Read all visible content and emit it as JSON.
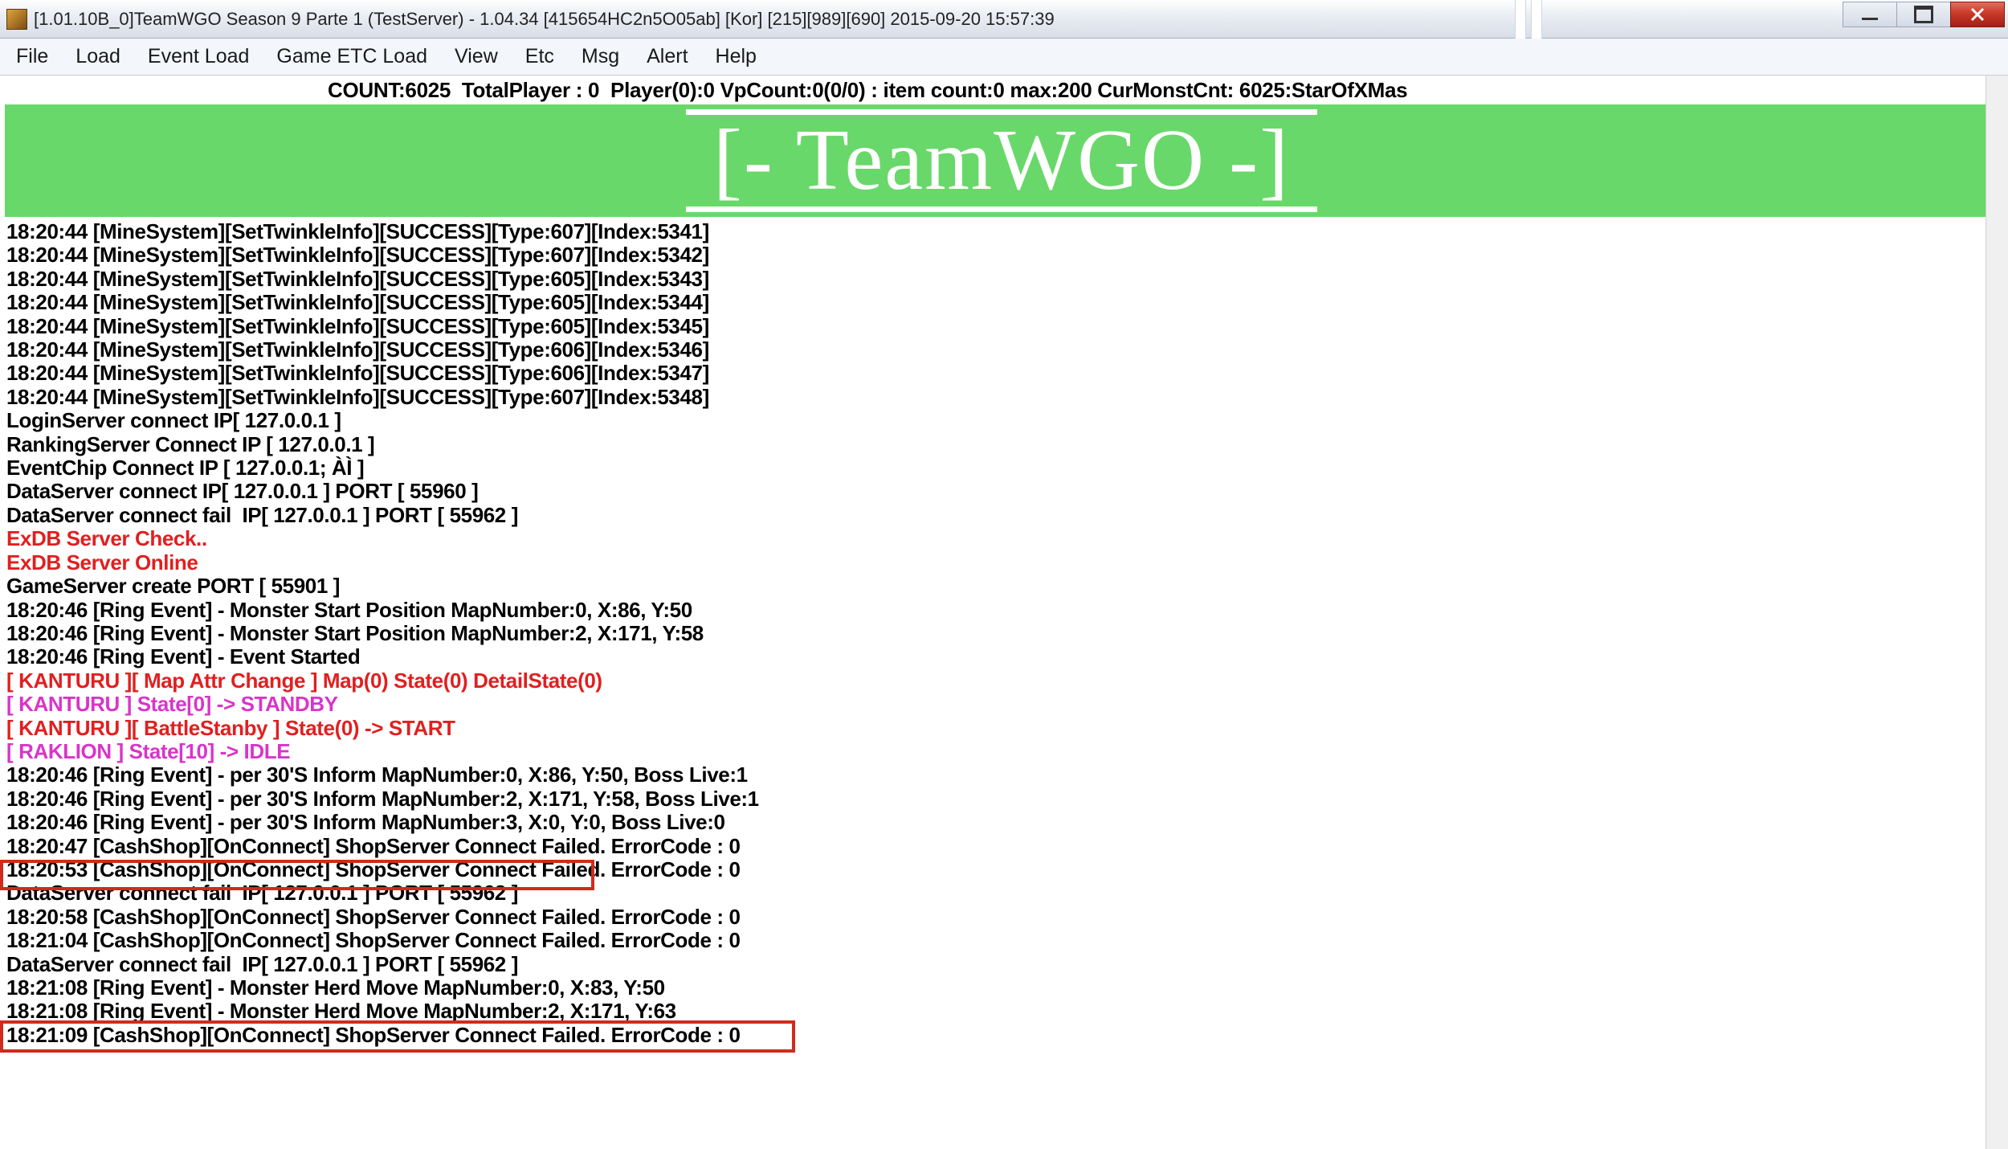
{
  "window": {
    "title": "[1.01.10B_0]TeamWGO Season 9 Parte 1 (TestServer) - 1.04.34 [415654HC2n5O05ab] [Kor] [215][989][690] 2015-09-20 15:57:39"
  },
  "menu": {
    "file": "File",
    "load": "Load",
    "event_load": "Event Load",
    "game_etc_load": "Game ETC Load",
    "view": "View",
    "etc": "Etc",
    "msg": "Msg",
    "alert": "Alert",
    "help": "Help"
  },
  "status_line": "COUNT:6025  TotalPlayer : 0  Player(0):0 VpCount:0(0/0) : item count:0 max:200 CurMonstCnt: 6025:StarOfXMas",
  "banner": "[-  TeamWGO -]",
  "log": {
    "lines": [
      {
        "t": "18:20:44 [MineSystem][SetTwinkleInfo][SUCCESS][Type:607][Index:5341]",
        "c": "k"
      },
      {
        "t": "18:20:44 [MineSystem][SetTwinkleInfo][SUCCESS][Type:607][Index:5342]",
        "c": "k"
      },
      {
        "t": "18:20:44 [MineSystem][SetTwinkleInfo][SUCCESS][Type:605][Index:5343]",
        "c": "k"
      },
      {
        "t": "18:20:44 [MineSystem][SetTwinkleInfo][SUCCESS][Type:605][Index:5344]",
        "c": "k"
      },
      {
        "t": "18:20:44 [MineSystem][SetTwinkleInfo][SUCCESS][Type:605][Index:5345]",
        "c": "k"
      },
      {
        "t": "18:20:44 [MineSystem][SetTwinkleInfo][SUCCESS][Type:606][Index:5346]",
        "c": "k"
      },
      {
        "t": "18:20:44 [MineSystem][SetTwinkleInfo][SUCCESS][Type:606][Index:5347]",
        "c": "k"
      },
      {
        "t": "18:20:44 [MineSystem][SetTwinkleInfo][SUCCESS][Type:607][Index:5348]",
        "c": "k"
      },
      {
        "t": "LoginServer connect IP[ 127.0.0.1 ]",
        "c": "k"
      },
      {
        "t": "RankingServer Connect IP [ 127.0.0.1 ]",
        "c": "k"
      },
      {
        "t": "EventChip Connect IP [ 127.0.0.1; ÀÌ ]",
        "c": "k"
      },
      {
        "t": "DataServer connect IP[ 127.0.0.1 ] PORT [ 55960 ]",
        "c": "k"
      },
      {
        "t": "DataServer connect fail  IP[ 127.0.0.1 ] PORT [ 55962 ]",
        "c": "k"
      },
      {
        "t": "ExDB Server Check..",
        "c": "r"
      },
      {
        "t": "ExDB Server Online",
        "c": "r"
      },
      {
        "t": "GameServer create PORT [ 55901 ]",
        "c": "k"
      },
      {
        "t": "18:20:46 [Ring Event] - Monster Start Position MapNumber:0, X:86, Y:50",
        "c": "k"
      },
      {
        "t": "18:20:46 [Ring Event] - Monster Start Position MapNumber:2, X:171, Y:58",
        "c": "k"
      },
      {
        "t": "18:20:46 [Ring Event] - Event Started",
        "c": "k"
      },
      {
        "t": "[ KANTURU ][ Map Attr Change ] Map(0) State(0) DetailState(0)",
        "c": "r"
      },
      {
        "t": "[ KANTURU ] State[0] -> STANDBY",
        "c": "m"
      },
      {
        "t": "[ KANTURU ][ BattleStanby ] State(0) -> START",
        "c": "r"
      },
      {
        "t": "[ RAKLION ] State[10] -> IDLE",
        "c": "m"
      },
      {
        "t": "18:20:46 [Ring Event] - per 30'S Inform MapNumber:0, X:86, Y:50, Boss Live:1",
        "c": "k"
      },
      {
        "t": "18:20:46 [Ring Event] - per 30'S Inform MapNumber:2, X:171, Y:58, Boss Live:1",
        "c": "k"
      },
      {
        "t": "18:20:46 [Ring Event] - per 30'S Inform MapNumber:3, X:0, Y:0, Boss Live:0",
        "c": "k"
      },
      {
        "t": "18:20:47 [CashShop][OnConnect] ShopServer Connect Failed. ErrorCode : 0",
        "c": "k"
      },
      {
        "t": "18:20:53 [CashShop][OnConnect] ShopServer Connect Failed. ErrorCode : 0",
        "c": "k"
      },
      {
        "t": "DataServer connect fail  IP[ 127.0.0.1 ] PORT [ 55962 ]",
        "c": "k"
      },
      {
        "t": "18:20:58 [CashShop][OnConnect] ShopServer Connect Failed. ErrorCode : 0",
        "c": "k"
      },
      {
        "t": "18:21:04 [CashShop][OnConnect] ShopServer Connect Failed. ErrorCode : 0",
        "c": "k"
      },
      {
        "t": "DataServer connect fail  IP[ 127.0.0.1 ] PORT [ 55962 ]",
        "c": "k"
      },
      {
        "t": "18:21:08 [Ring Event] - Monster Herd Move MapNumber:0, X:83, Y:50",
        "c": "k"
      },
      {
        "t": "18:21:08 [Ring Event] - Monster Herd Move MapNumber:2, X:171, Y:63",
        "c": "k"
      },
      {
        "t": "18:21:09 [CashShop][OnConnect] ShopServer Connect Failed. ErrorCode : 0",
        "c": "k"
      }
    ]
  }
}
